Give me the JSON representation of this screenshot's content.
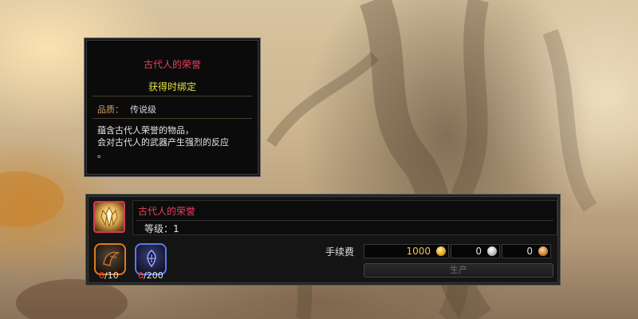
{
  "tooltip": {
    "title": "古代人的荣誉",
    "bind_type": "获得时绑定",
    "quality_label": "品质：",
    "quality_value": "传说级",
    "description": [
      "蕴含古代人荣誉的物品，",
      "会对古代人的武器产生强烈的反应",
      "。"
    ]
  },
  "craft": {
    "item_name": "古代人的荣誉",
    "level_text": "等级：1",
    "materials": [
      {
        "icon": "dark-material-icon",
        "have": "0",
        "need": "/10"
      },
      {
        "icon": "spirit-material-icon",
        "have": "0",
        "need": "/200"
      }
    ],
    "fee_label": "手续费",
    "fees": [
      {
        "amount": "1000",
        "coin": "gold"
      },
      {
        "amount": "0",
        "coin": "silver"
      },
      {
        "amount": "0",
        "coin": "copper"
      }
    ],
    "produce_label": "生产"
  },
  "colors": {
    "legendary_name": "#e8415d",
    "bind_text": "#e6e14a",
    "quality_label": "#d9a05a",
    "insufficient": "#ff3b3b"
  }
}
